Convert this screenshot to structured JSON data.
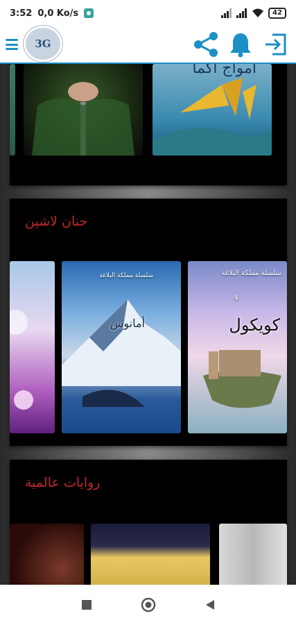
{
  "status_bar": {
    "time": "3:52",
    "net_speed": "0,0 Ko/s",
    "battery": "42"
  },
  "app_bar": {
    "logo_text": "3G",
    "icons": [
      "menu-icon",
      "share-icon",
      "bell-icon",
      "exit-icon"
    ],
    "accent": "#1d8fc7"
  },
  "sections": [
    {
      "title": "",
      "books": [
        {
          "title": ""
        },
        {
          "title": ""
        },
        {
          "title": "أمواج أكما"
        }
      ]
    },
    {
      "title": "حنان لاشين",
      "books": [
        {
          "title": ""
        },
        {
          "series": "سلسلة مملكة البلاغة",
          "title": "أمانوس"
        },
        {
          "series": "سلسلة مملكة البلاغة",
          "number": "4",
          "title": "كويكول"
        }
      ]
    },
    {
      "title": "روايات عالمية",
      "books": [
        {
          "title": ""
        },
        {
          "title": ""
        },
        {
          "title": ""
        }
      ]
    }
  ],
  "colors": {
    "section_title": "#c0282a",
    "section_bg": "#000000"
  },
  "nav_bar": {
    "icons": [
      "recent-apps-icon",
      "home-icon",
      "back-icon"
    ]
  }
}
